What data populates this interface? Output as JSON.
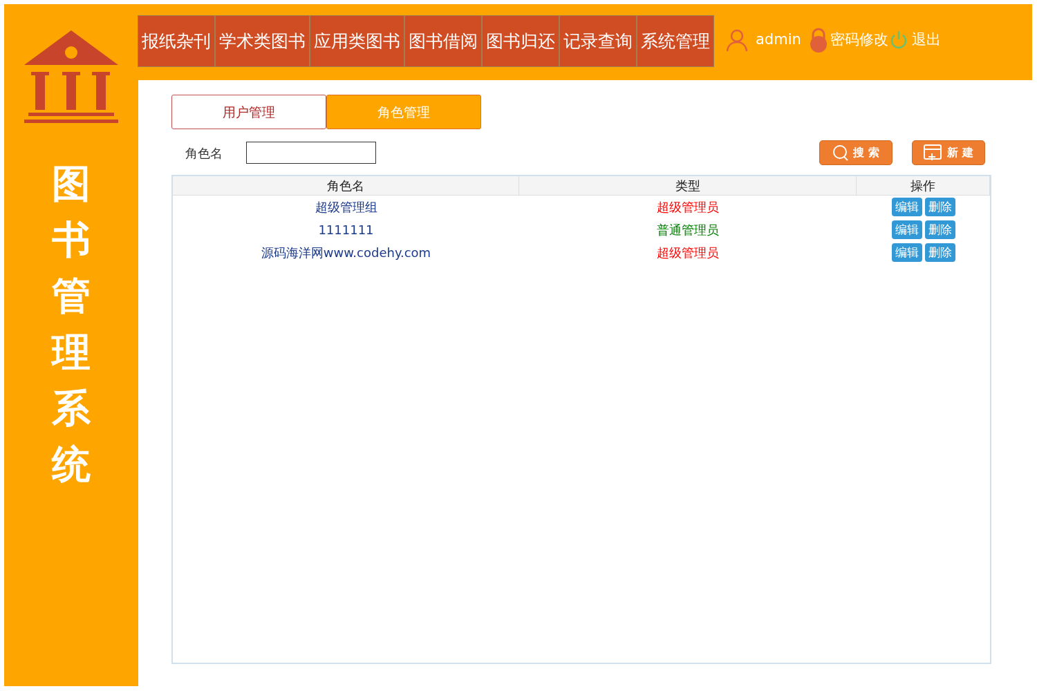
{
  "sidebar": {
    "title": "图书管理系统"
  },
  "nav": [
    {
      "label": "报纸杂刊"
    },
    {
      "label": "学术类图书"
    },
    {
      "label": "应用类图书"
    },
    {
      "label": "图书借阅"
    },
    {
      "label": "图书归还"
    },
    {
      "label": "记录查询"
    },
    {
      "label": "系统管理"
    }
  ],
  "user": {
    "name": "admin",
    "change_password": "密码修改",
    "logout": "退出"
  },
  "tabs": [
    {
      "label": "用户管理",
      "selected": false
    },
    {
      "label": "角色管理",
      "selected": true
    }
  ],
  "filter": {
    "label": "角色名"
  },
  "buttons": {
    "search": "搜 索",
    "create": "新 建"
  },
  "table": {
    "columns": [
      "角色名",
      "类型",
      "操作"
    ],
    "rows": [
      {
        "name": "超级管理组",
        "type": "超级管理员",
        "color": "#ff0000",
        "actions": [
          "编辑",
          "删除"
        ]
      },
      {
        "name": "1111111",
        "type": "普通管理员",
        "color": "#008000",
        "actions": [
          "编辑",
          "删除"
        ]
      },
      {
        "name": "源码海洋网www.codehy.com",
        "type": "超级管理员",
        "color": "#ff0000",
        "actions": [
          "编辑",
          "删除"
        ]
      }
    ]
  }
}
